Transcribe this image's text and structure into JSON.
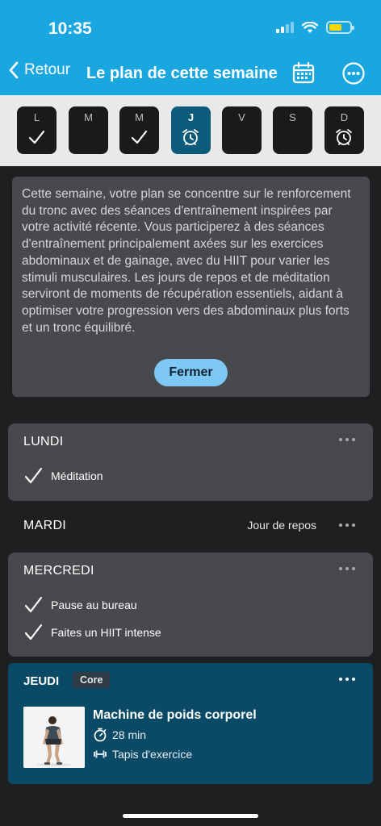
{
  "status_bar": {
    "time": "10:35",
    "battery_color": "#ffd60a"
  },
  "nav": {
    "back_label": "Retour",
    "title": "Le plan de cette semaine",
    "calendar_icon": "calendar-icon",
    "more_icon": "more-icon"
  },
  "days": [
    {
      "letter": "L",
      "mark": "check",
      "active": false
    },
    {
      "letter": "M",
      "mark": "none",
      "active": false
    },
    {
      "letter": "M",
      "mark": "check",
      "active": false
    },
    {
      "letter": "J",
      "mark": "alarm",
      "active": true
    },
    {
      "letter": "V",
      "mark": "none",
      "active": false
    },
    {
      "letter": "S",
      "mark": "none",
      "active": false
    },
    {
      "letter": "D",
      "mark": "alarm",
      "active": false
    }
  ],
  "summary": {
    "text": "Cette semaine, votre plan se concentre sur le renforcement du tronc avec des séances d'entraînement inspirées par votre activité récente. Vous participerez à des séances d'entraînement principalement axées sur les exercices abdominaux et de gainage, avec du HIIT pour varier les stimuli musculaires. Les jours de repos et de méditation serviront de moments de récupération essentiels, aidant à optimiser votre progression vers des abdominaux plus forts et un tronc équilibré.",
    "close_label": "Fermer"
  },
  "lundi": {
    "title": "LUNDI",
    "items": [
      "Méditation"
    ]
  },
  "mardi": {
    "title": "MARDI",
    "status": "Jour de repos"
  },
  "mercredi": {
    "title": "MERCREDI",
    "items": [
      "Pause au bureau",
      "Faites un HIIT intense"
    ]
  },
  "jeudi": {
    "title": "JEUDI",
    "badge": "Core",
    "workout": {
      "title": "Machine de poids corporel",
      "duration": "28 min",
      "equipment": "Tapis d'exercice"
    }
  },
  "colors": {
    "header": "#1aa7e0",
    "accent_button": "#7ec8f5",
    "thursday_card": "#0b4a66",
    "active_day": "#0d5b7a"
  }
}
